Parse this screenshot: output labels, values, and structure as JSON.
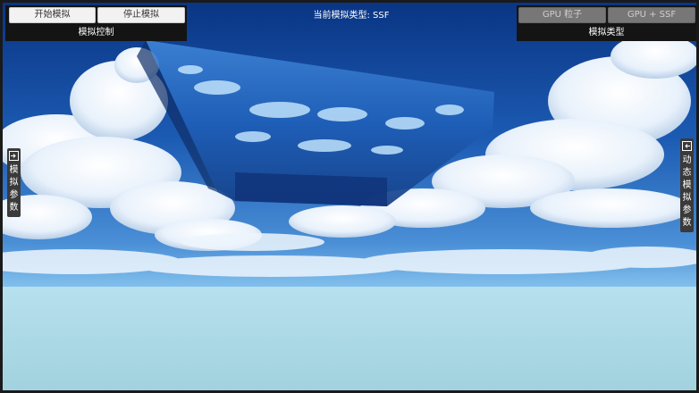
{
  "simulation_control": {
    "start_label": "开始模拟",
    "stop_label": "停止模拟",
    "panel_title": "模拟控制"
  },
  "status": {
    "current_type": "当前模拟类型: SSF"
  },
  "simulation_type": {
    "gpu_particles_label": "GPU 粒子",
    "gpu_ssf_label": "GPU + SSF",
    "panel_title": "模拟类型"
  },
  "side_tabs": {
    "left": {
      "icon": "exit-panel-icon",
      "label": "模拟参数"
    },
    "right": {
      "icon": "exit-panel-icon",
      "label": "动态模拟参数"
    }
  },
  "colors": {
    "sky_top": "#0b3b8c",
    "sky_horizon": "#7fc0ec",
    "ground": "#a9d8e6",
    "fluid": "#1f5fb8"
  }
}
